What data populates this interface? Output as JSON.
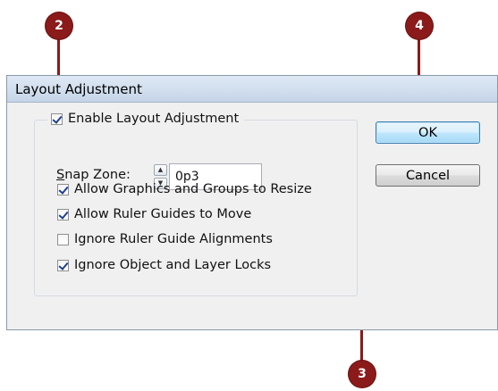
{
  "dialog": {
    "title": "Layout Adjustment",
    "enable_label": "Enable Layout Adjustment",
    "enable_checked": true,
    "snap_zone": {
      "label_underlined": "S",
      "label_rest": "nap Zone:",
      "value": "0p3"
    },
    "options": [
      {
        "label": "Allow Graphics and Groups to Resize",
        "checked": true
      },
      {
        "label": "Allow Ruler Guides to Move",
        "checked": true
      },
      {
        "label": "Ignore Ruler Guide Alignments",
        "checked": false
      },
      {
        "label": "Ignore Object and Layer Locks",
        "checked": true
      }
    ],
    "buttons": {
      "ok": "OK",
      "cancel": "Cancel"
    }
  },
  "callouts": {
    "enable": "2",
    "options": "3",
    "ok": "4"
  },
  "colors": {
    "callout": "#8b1a1a"
  }
}
